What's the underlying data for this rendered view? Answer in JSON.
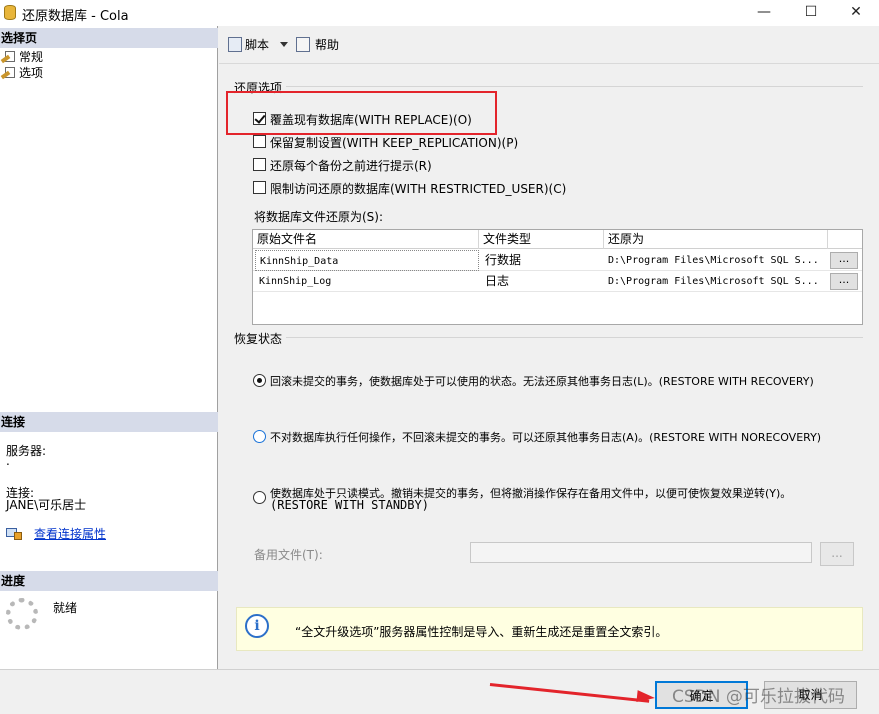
{
  "window": {
    "title": "还原数据库 - Cola",
    "minimize": "—",
    "maximize": "☐",
    "close": "✕"
  },
  "left": {
    "select_page_header": "选择页",
    "pages": [
      {
        "label": "常规",
        "icon": "page-wrench-icon"
      },
      {
        "label": "选项",
        "icon": "page-wrench-icon"
      }
    ],
    "connection_header": "连接",
    "server_label": "服务器:",
    "server_value": ".",
    "connection_label": "连接:",
    "connection_value": "JANE\\可乐居士",
    "view_connection_link": "查看连接属性",
    "progress_header": "进度",
    "progress_status": "就绪"
  },
  "toolbar": {
    "script_label": "脚本",
    "help_label": "帮助"
  },
  "restore_options": {
    "group_label": "还原选项",
    "options": [
      {
        "label": "覆盖现有数据库(WITH REPLACE)(O)",
        "checked": true
      },
      {
        "label": "保留复制设置(WITH KEEP_REPLICATION)(P)",
        "checked": false
      },
      {
        "label": "还原每个备份之前进行提示(R)",
        "checked": false
      },
      {
        "label": "限制访问还原的数据库(WITH RESTRICTED_USER)(C)",
        "checked": false
      }
    ],
    "files_label": "将数据库文件还原为(S):",
    "grid": {
      "columns": [
        "原始文件名",
        "文件类型",
        "还原为"
      ],
      "rows": [
        {
          "original": "KinnShip_Data",
          "type": "行数据",
          "restore_as": "D:\\Program Files\\Microsoft SQL S...",
          "button": "..."
        },
        {
          "original": "KinnShip_Log",
          "type": "日志",
          "restore_as": "D:\\Program Files\\Microsoft SQL S...",
          "button": "..."
        }
      ]
    }
  },
  "recovery_state": {
    "group_label": "恢复状态",
    "options": [
      {
        "label": "回滚未提交的事务，使数据库处于可以使用的状态。无法还原其他事务日志(L)。(RESTORE WITH RECOVERY)",
        "selected": true
      },
      {
        "label": "不对数据库执行任何操作，不回滚未提交的事务。可以还原其他事务日志(A)。(RESTORE WITH NORECOVERY)",
        "selected": false
      },
      {
        "label_line1": "使数据库处于只读模式。撤销未提交的事务，但将撤消操作保存在备用文件中，以便可使恢复效果逆转(Y)。",
        "label_line2": "(RESTORE WITH STANDBY)",
        "selected": false
      }
    ],
    "standby_file_label": "备用文件(T):",
    "standby_file_value": "",
    "standby_browse": "..."
  },
  "info": {
    "icon": "info-icon",
    "text": "“全文升级选项”服务器属性控制是导入、重新生成还是重置全文索引。"
  },
  "buttons": {
    "ok": "确定",
    "cancel": "取消"
  },
  "watermark": "CSDN @可乐拉拔代码",
  "colors": {
    "annotation": "#e3242b",
    "section_header": "#d6dbe9",
    "link": "#0033cc",
    "info_bg": "#ffffe1"
  }
}
